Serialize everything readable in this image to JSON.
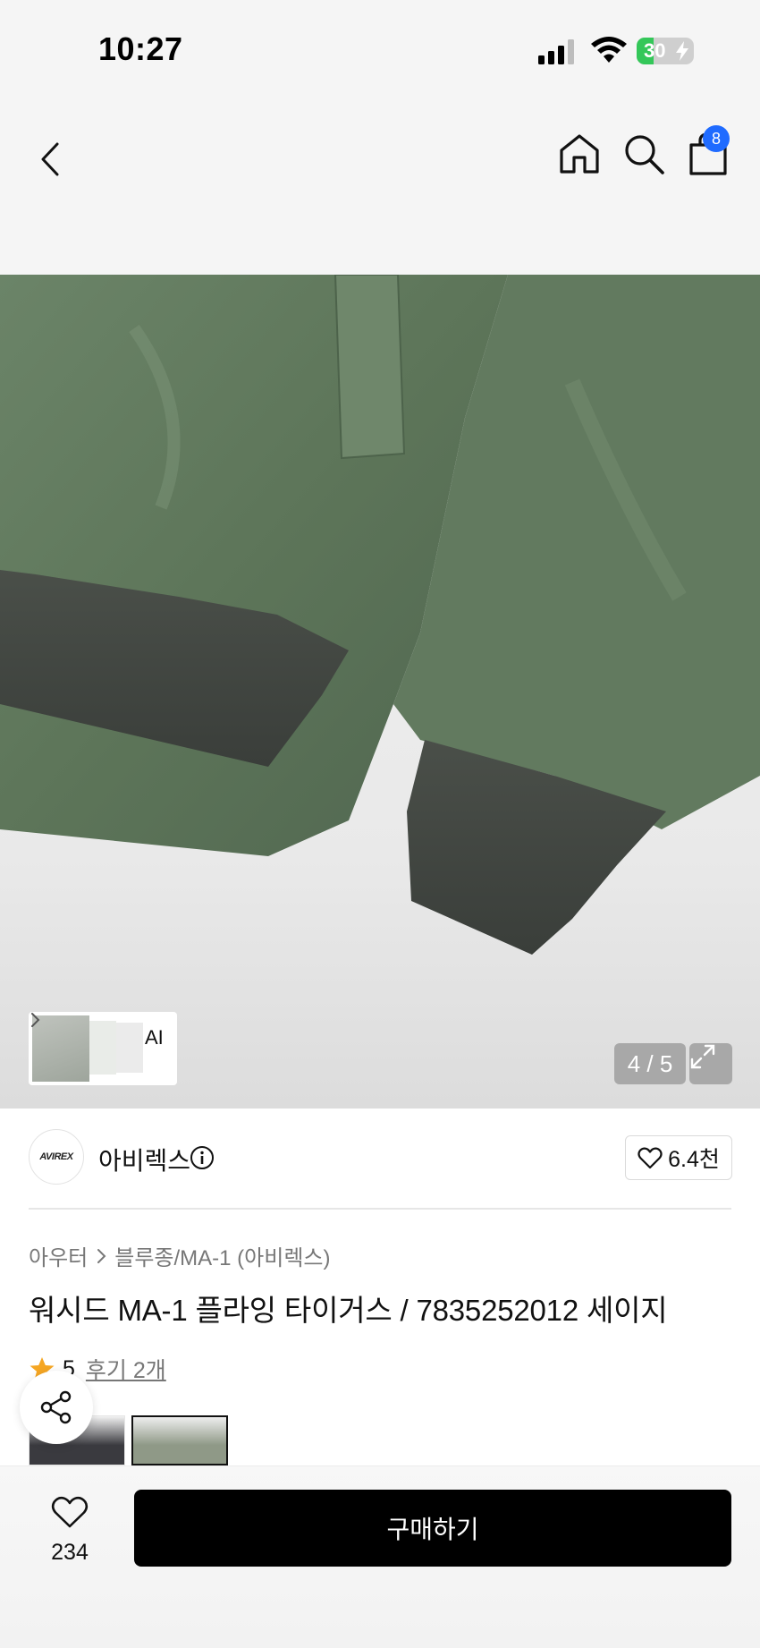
{
  "status_bar": {
    "time": "10:27",
    "battery_percent": "30",
    "battery_level": 0.3
  },
  "header": {
    "cart_badge": "8"
  },
  "gallery": {
    "ai_label": "AI",
    "page_counter": "4 / 5"
  },
  "brand": {
    "logo_text": "AVIREX",
    "name": "아비렉스",
    "likes": "6.4천"
  },
  "breadcrumb": {
    "category": "아우터",
    "subcategory": "블루종/MA-1 (아비렉스)"
  },
  "product": {
    "title": "워시드 MA-1 플라잉 타이거스 / 7835252012 세이지",
    "rating": "5",
    "review_link": "후기 2개"
  },
  "bottom_bar": {
    "wish_count": "234",
    "buy_label": "구매하기"
  },
  "colors": {
    "brand_accent": "#1f6bff",
    "buy_button": "#000000",
    "star": "#f5a623"
  }
}
